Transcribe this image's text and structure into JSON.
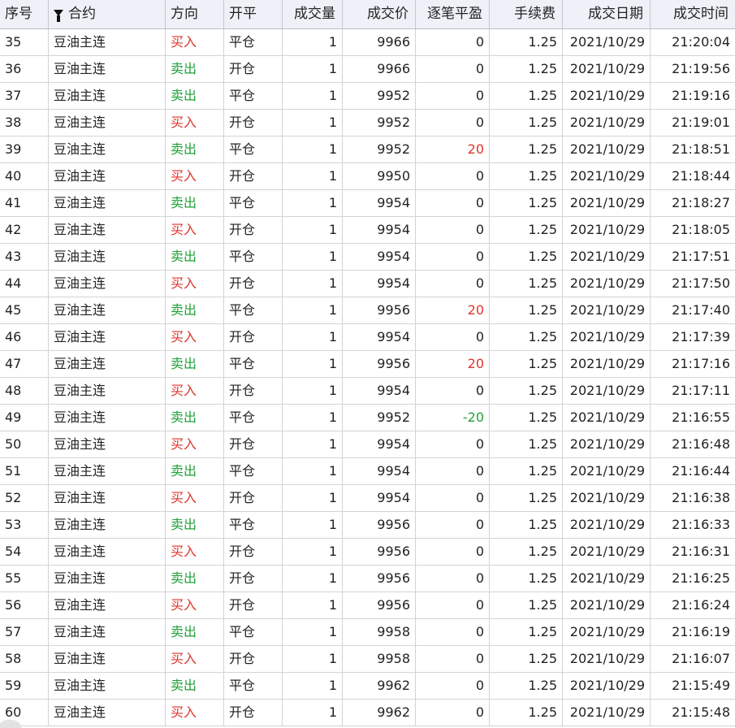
{
  "table": {
    "headers": {
      "seq": "序号",
      "contract": "合约",
      "direction": "方向",
      "open_close": "开平",
      "qty": "成交量",
      "price": "成交价",
      "pnl": "逐笔平盈",
      "fee": "手续费",
      "date": "成交日期",
      "time": "成交时间"
    },
    "colors": {
      "buy": "#e0342b",
      "sell": "#22a03a"
    },
    "rows": [
      {
        "seq": "35",
        "contract": "豆油主连",
        "direction": "买入",
        "side": "buy",
        "open_close": "平仓",
        "qty": "1",
        "price": "9966",
        "pnl": "0",
        "fee": "1.25",
        "date": "2021/10/29",
        "time": "21:20:04"
      },
      {
        "seq": "36",
        "contract": "豆油主连",
        "direction": "卖出",
        "side": "sell",
        "open_close": "开仓",
        "qty": "1",
        "price": "9966",
        "pnl": "0",
        "fee": "1.25",
        "date": "2021/10/29",
        "time": "21:19:56"
      },
      {
        "seq": "37",
        "contract": "豆油主连",
        "direction": "卖出",
        "side": "sell",
        "open_close": "平仓",
        "qty": "1",
        "price": "9952",
        "pnl": "0",
        "fee": "1.25",
        "date": "2021/10/29",
        "time": "21:19:16"
      },
      {
        "seq": "38",
        "contract": "豆油主连",
        "direction": "买入",
        "side": "buy",
        "open_close": "开仓",
        "qty": "1",
        "price": "9952",
        "pnl": "0",
        "fee": "1.25",
        "date": "2021/10/29",
        "time": "21:19:01"
      },
      {
        "seq": "39",
        "contract": "豆油主连",
        "direction": "卖出",
        "side": "sell",
        "open_close": "平仓",
        "qty": "1",
        "price": "9952",
        "pnl": "20",
        "fee": "1.25",
        "date": "2021/10/29",
        "time": "21:18:51"
      },
      {
        "seq": "40",
        "contract": "豆油主连",
        "direction": "买入",
        "side": "buy",
        "open_close": "开仓",
        "qty": "1",
        "price": "9950",
        "pnl": "0",
        "fee": "1.25",
        "date": "2021/10/29",
        "time": "21:18:44"
      },
      {
        "seq": "41",
        "contract": "豆油主连",
        "direction": "卖出",
        "side": "sell",
        "open_close": "平仓",
        "qty": "1",
        "price": "9954",
        "pnl": "0",
        "fee": "1.25",
        "date": "2021/10/29",
        "time": "21:18:27"
      },
      {
        "seq": "42",
        "contract": "豆油主连",
        "direction": "买入",
        "side": "buy",
        "open_close": "开仓",
        "qty": "1",
        "price": "9954",
        "pnl": "0",
        "fee": "1.25",
        "date": "2021/10/29",
        "time": "21:18:05"
      },
      {
        "seq": "43",
        "contract": "豆油主连",
        "direction": "卖出",
        "side": "sell",
        "open_close": "平仓",
        "qty": "1",
        "price": "9954",
        "pnl": "0",
        "fee": "1.25",
        "date": "2021/10/29",
        "time": "21:17:51"
      },
      {
        "seq": "44",
        "contract": "豆油主连",
        "direction": "买入",
        "side": "buy",
        "open_close": "开仓",
        "qty": "1",
        "price": "9954",
        "pnl": "0",
        "fee": "1.25",
        "date": "2021/10/29",
        "time": "21:17:50"
      },
      {
        "seq": "45",
        "contract": "豆油主连",
        "direction": "卖出",
        "side": "sell",
        "open_close": "平仓",
        "qty": "1",
        "price": "9956",
        "pnl": "20",
        "fee": "1.25",
        "date": "2021/10/29",
        "time": "21:17:40"
      },
      {
        "seq": "46",
        "contract": "豆油主连",
        "direction": "买入",
        "side": "buy",
        "open_close": "开仓",
        "qty": "1",
        "price": "9954",
        "pnl": "0",
        "fee": "1.25",
        "date": "2021/10/29",
        "time": "21:17:39"
      },
      {
        "seq": "47",
        "contract": "豆油主连",
        "direction": "卖出",
        "side": "sell",
        "open_close": "平仓",
        "qty": "1",
        "price": "9956",
        "pnl": "20",
        "fee": "1.25",
        "date": "2021/10/29",
        "time": "21:17:16"
      },
      {
        "seq": "48",
        "contract": "豆油主连",
        "direction": "买入",
        "side": "buy",
        "open_close": "开仓",
        "qty": "1",
        "price": "9954",
        "pnl": "0",
        "fee": "1.25",
        "date": "2021/10/29",
        "time": "21:17:11"
      },
      {
        "seq": "49",
        "contract": "豆油主连",
        "direction": "卖出",
        "side": "sell",
        "open_close": "平仓",
        "qty": "1",
        "price": "9952",
        "pnl": "-20",
        "fee": "1.25",
        "date": "2021/10/29",
        "time": "21:16:55"
      },
      {
        "seq": "50",
        "contract": "豆油主连",
        "direction": "买入",
        "side": "buy",
        "open_close": "开仓",
        "qty": "1",
        "price": "9954",
        "pnl": "0",
        "fee": "1.25",
        "date": "2021/10/29",
        "time": "21:16:48"
      },
      {
        "seq": "51",
        "contract": "豆油主连",
        "direction": "卖出",
        "side": "sell",
        "open_close": "平仓",
        "qty": "1",
        "price": "9954",
        "pnl": "0",
        "fee": "1.25",
        "date": "2021/10/29",
        "time": "21:16:44"
      },
      {
        "seq": "52",
        "contract": "豆油主连",
        "direction": "买入",
        "side": "buy",
        "open_close": "开仓",
        "qty": "1",
        "price": "9954",
        "pnl": "0",
        "fee": "1.25",
        "date": "2021/10/29",
        "time": "21:16:38"
      },
      {
        "seq": "53",
        "contract": "豆油主连",
        "direction": "卖出",
        "side": "sell",
        "open_close": "平仓",
        "qty": "1",
        "price": "9956",
        "pnl": "0",
        "fee": "1.25",
        "date": "2021/10/29",
        "time": "21:16:33"
      },
      {
        "seq": "54",
        "contract": "豆油主连",
        "direction": "买入",
        "side": "buy",
        "open_close": "开仓",
        "qty": "1",
        "price": "9956",
        "pnl": "0",
        "fee": "1.25",
        "date": "2021/10/29",
        "time": "21:16:31"
      },
      {
        "seq": "55",
        "contract": "豆油主连",
        "direction": "卖出",
        "side": "sell",
        "open_close": "开仓",
        "qty": "1",
        "price": "9956",
        "pnl": "0",
        "fee": "1.25",
        "date": "2021/10/29",
        "time": "21:16:25"
      },
      {
        "seq": "56",
        "contract": "豆油主连",
        "direction": "买入",
        "side": "buy",
        "open_close": "开仓",
        "qty": "1",
        "price": "9956",
        "pnl": "0",
        "fee": "1.25",
        "date": "2021/10/29",
        "time": "21:16:24"
      },
      {
        "seq": "57",
        "contract": "豆油主连",
        "direction": "卖出",
        "side": "sell",
        "open_close": "平仓",
        "qty": "1",
        "price": "9958",
        "pnl": "0",
        "fee": "1.25",
        "date": "2021/10/29",
        "time": "21:16:19"
      },
      {
        "seq": "58",
        "contract": "豆油主连",
        "direction": "买入",
        "side": "buy",
        "open_close": "开仓",
        "qty": "1",
        "price": "9958",
        "pnl": "0",
        "fee": "1.25",
        "date": "2021/10/29",
        "time": "21:16:07"
      },
      {
        "seq": "59",
        "contract": "豆油主连",
        "direction": "卖出",
        "side": "sell",
        "open_close": "平仓",
        "qty": "1",
        "price": "9962",
        "pnl": "0",
        "fee": "1.25",
        "date": "2021/10/29",
        "time": "21:15:49"
      },
      {
        "seq": "60",
        "contract": "豆油主连",
        "direction": "买入",
        "side": "buy",
        "open_close": "开仓",
        "qty": "1",
        "price": "9962",
        "pnl": "0",
        "fee": "1.25",
        "date": "2021/10/29",
        "time": "21:15:48"
      }
    ]
  }
}
